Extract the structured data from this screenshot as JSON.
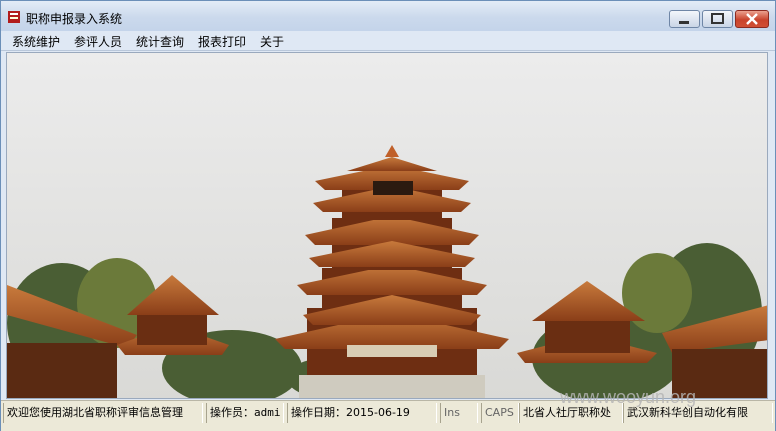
{
  "window": {
    "title": "职称申报录入系统",
    "icon": "book-icon",
    "controls": {
      "minimize": "minimize-icon",
      "maximize": "maximize-icon",
      "close": "close-icon"
    }
  },
  "menu": [
    "系统维护",
    "参评人员",
    "统计查询",
    "报表打印",
    "关于"
  ],
  "main": {
    "image": "yellow-crane-tower-photo"
  },
  "status": {
    "welcome": "欢迎您使用湖北省职称评审信息管理",
    "operator": "操作员：admi",
    "date": "操作日期：2015-06-19",
    "ins": "Ins",
    "caps": "CAPS",
    "org": "北省人社厅职称处",
    "company": "武汉新科华创自动化有限"
  },
  "watermark": "www.wooyun.org"
}
